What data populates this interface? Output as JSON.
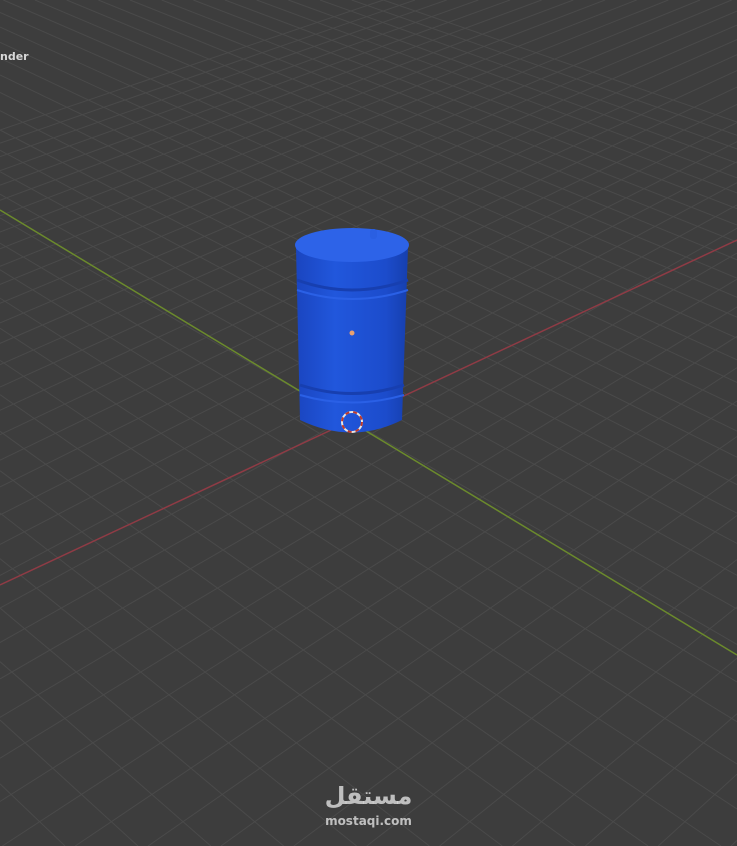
{
  "viewport": {
    "object_label": "nder",
    "colors": {
      "background": "#3d3d3d",
      "grid": "#4a4a4a",
      "x_axis": "#8f3b45",
      "y_axis": "#6b8a2c",
      "object": "#1f52d8"
    }
  },
  "watermark": {
    "arabic": "مستقل",
    "latin": "mostaqi.com"
  }
}
